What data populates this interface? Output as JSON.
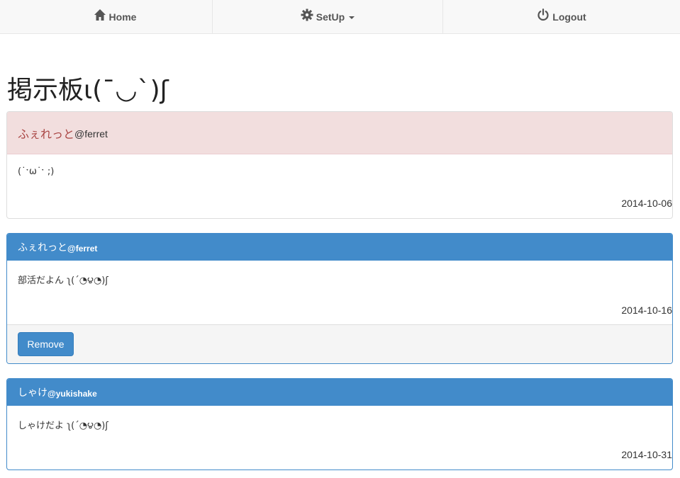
{
  "nav": {
    "home": {
      "label": "Home",
      "icon": "home-icon"
    },
    "setup": {
      "label": "SetUp",
      "icon": "gear-icon"
    },
    "logout": {
      "label": "Logout",
      "icon": "power-icon"
    }
  },
  "page": {
    "title": "掲示板ɩ(¯◡ˋ)ʃ"
  },
  "posts": [
    {
      "style": "danger",
      "author_name": "ふぇれっと",
      "author_handle": "@ferret",
      "body": "(˙ˑω˙ˑ ;)",
      "date": "2014-10-06"
    },
    {
      "style": "primary",
      "author_name": "ふぇれっと",
      "author_handle": "@ferret",
      "body": "部活だよん ʅ(´◔౪◔)ʃ",
      "date": "2014-10-16",
      "remove_label": "Remove"
    },
    {
      "style": "primary",
      "author_name": "しゃけ",
      "author_handle": "@yukishake",
      "body": "しゃけだよ ʅ(´◔౪◔)ʃ",
      "date": "2014-10-31"
    }
  ],
  "colors": {
    "primary": "#428bca",
    "danger_bg": "#f2dede",
    "danger_text": "#a94442",
    "nav_bg": "#f8f8f8"
  }
}
